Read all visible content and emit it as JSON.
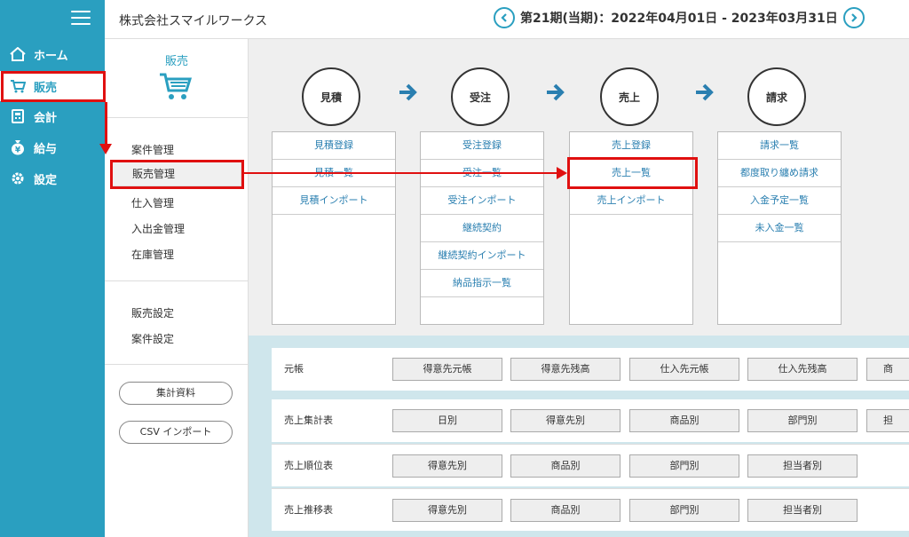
{
  "nav": {
    "items": [
      {
        "label": "ホーム",
        "icon": "home-icon"
      },
      {
        "label": "販売",
        "icon": "cart-icon"
      },
      {
        "label": "会計",
        "icon": "calculator-icon"
      },
      {
        "label": "給与",
        "icon": "money-bag-icon"
      },
      {
        "label": "設定",
        "icon": "gear-icon"
      }
    ]
  },
  "header": {
    "company": "株式会社スマイルワークス",
    "period": "第21期(当期)：2022年04月01日 - 2023年03月31日"
  },
  "subnav": {
    "title": "販売",
    "items": [
      "案件管理",
      "販売管理",
      "仕入管理",
      "入出金管理",
      "在庫管理"
    ],
    "settings": [
      "販売設定",
      "案件設定"
    ],
    "buttons": [
      "集計資料",
      "CSV インポート"
    ]
  },
  "flow": {
    "steps": [
      "見積",
      "受注",
      "売上",
      "請求"
    ],
    "columns": [
      [
        "見積登録",
        "見積一覧",
        "見積インポート"
      ],
      [
        "受注登録",
        "受注一覧",
        "受注インポート",
        "継続契約",
        "継続契約インポート",
        "納品指示一覧"
      ],
      [
        "売上登録",
        "売上一覧",
        "売上インポート"
      ],
      [
        "請求一覧",
        "都度取り纏め請求",
        "入金予定一覧",
        "未入金一覧"
      ]
    ]
  },
  "reports": [
    {
      "label": "元帳",
      "buttons": [
        "得意先元帳",
        "得意先残高",
        "仕入先元帳",
        "仕入先残高",
        "商"
      ]
    },
    {
      "label": "売上集計表",
      "buttons": [
        "日別",
        "得意先別",
        "商品別",
        "部門別",
        "担"
      ]
    },
    {
      "label": "売上順位表",
      "buttons": [
        "得意先別",
        "商品別",
        "部門別",
        "担当者別"
      ]
    },
    {
      "label": "売上推移表",
      "buttons": [
        "得意先別",
        "商品別",
        "部門別",
        "担当者別"
      ]
    }
  ],
  "colors": {
    "accent": "#2a9fc0",
    "highlight": "#e01010"
  }
}
